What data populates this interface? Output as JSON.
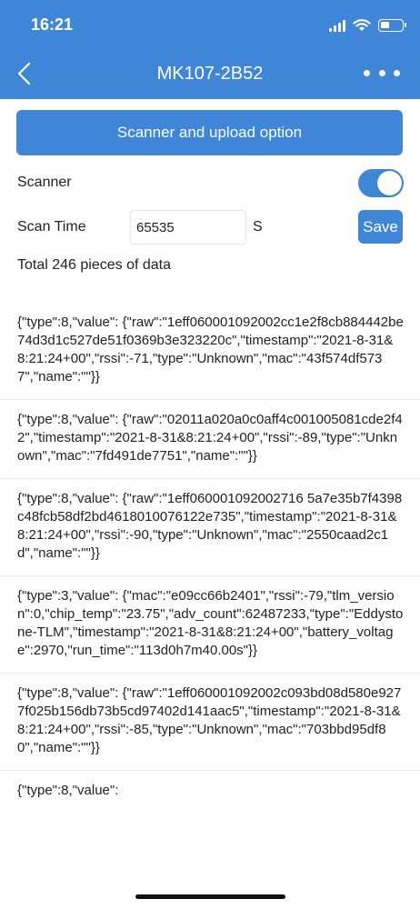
{
  "status_bar": {
    "time": "16:21"
  },
  "nav": {
    "title": "MK107-2B52"
  },
  "upload_button": {
    "label": "Scanner and upload option"
  },
  "scanner": {
    "label": "Scanner",
    "enabled": true
  },
  "scan_time": {
    "label": "Scan Time",
    "value": "65535",
    "unit": "S",
    "save_label": "Save"
  },
  "total": {
    "text": "Total 246 pieces of data"
  },
  "items": [
    {
      "text": "{\"type\":8,\"value\":\n{\"raw\":\"1eff060001092002cc1e2f8cb884442be74d3d1c527de51f0369b3e323220c\",\"timestamp\":\"2021-8-31&8:21:24+00\",\"rssi\":-71,\"type\":\"Unknown\",\"mac\":\"43f574df5737\",\"name\":\"\"}}"
    },
    {
      "text": "{\"type\":8,\"value\":\n{\"raw\":\"02011a020a0c0aff4c001005081cde2f42\",\"timestamp\":\"2021-8-31&8:21:24+00\",\"rssi\":-89,\"type\":\"Unknown\",\"mac\":\"7fd491de7751\",\"name\":\"\"}}"
    },
    {
      "text": "{\"type\":8,\"value\":\n{\"raw\":\"1eff060001092002716 5a7e35b7f4398c48fcb58df2bd4618010076122e735\",\"timestamp\":\"2021-8-31&8:21:24+00\",\"rssi\":-90,\"type\":\"Unknown\",\"mac\":\"2550caad2c1d\",\"name\":\"\"}}"
    },
    {
      "text": "{\"type\":3,\"value\":\n{\"mac\":\"e09cc66b2401\",\"rssi\":-79,\"tlm_version\":0,\"chip_temp\":\"23.75\",\"adv_count\":62487233,\"type\":\"Eddystone-TLM\",\"timestamp\":\"2021-8-31&8:21:24+00\",\"battery_voltage\":2970,\"run_time\":\"113d0h7m40.00s\"}}"
    },
    {
      "text": "{\"type\":8,\"value\":\n{\"raw\":\"1eff060001092002c093bd08d580e9277f025b156db73b5cd97402d141aac5\",\"timestamp\":\"2021-8-31&8:21:24+00\",\"rssi\":-85,\"type\":\"Unknown\",\"mac\":\"703bbd95df80\",\"name\":\"\"}}"
    },
    {
      "text": "{\"type\":8,\"value\":"
    }
  ]
}
